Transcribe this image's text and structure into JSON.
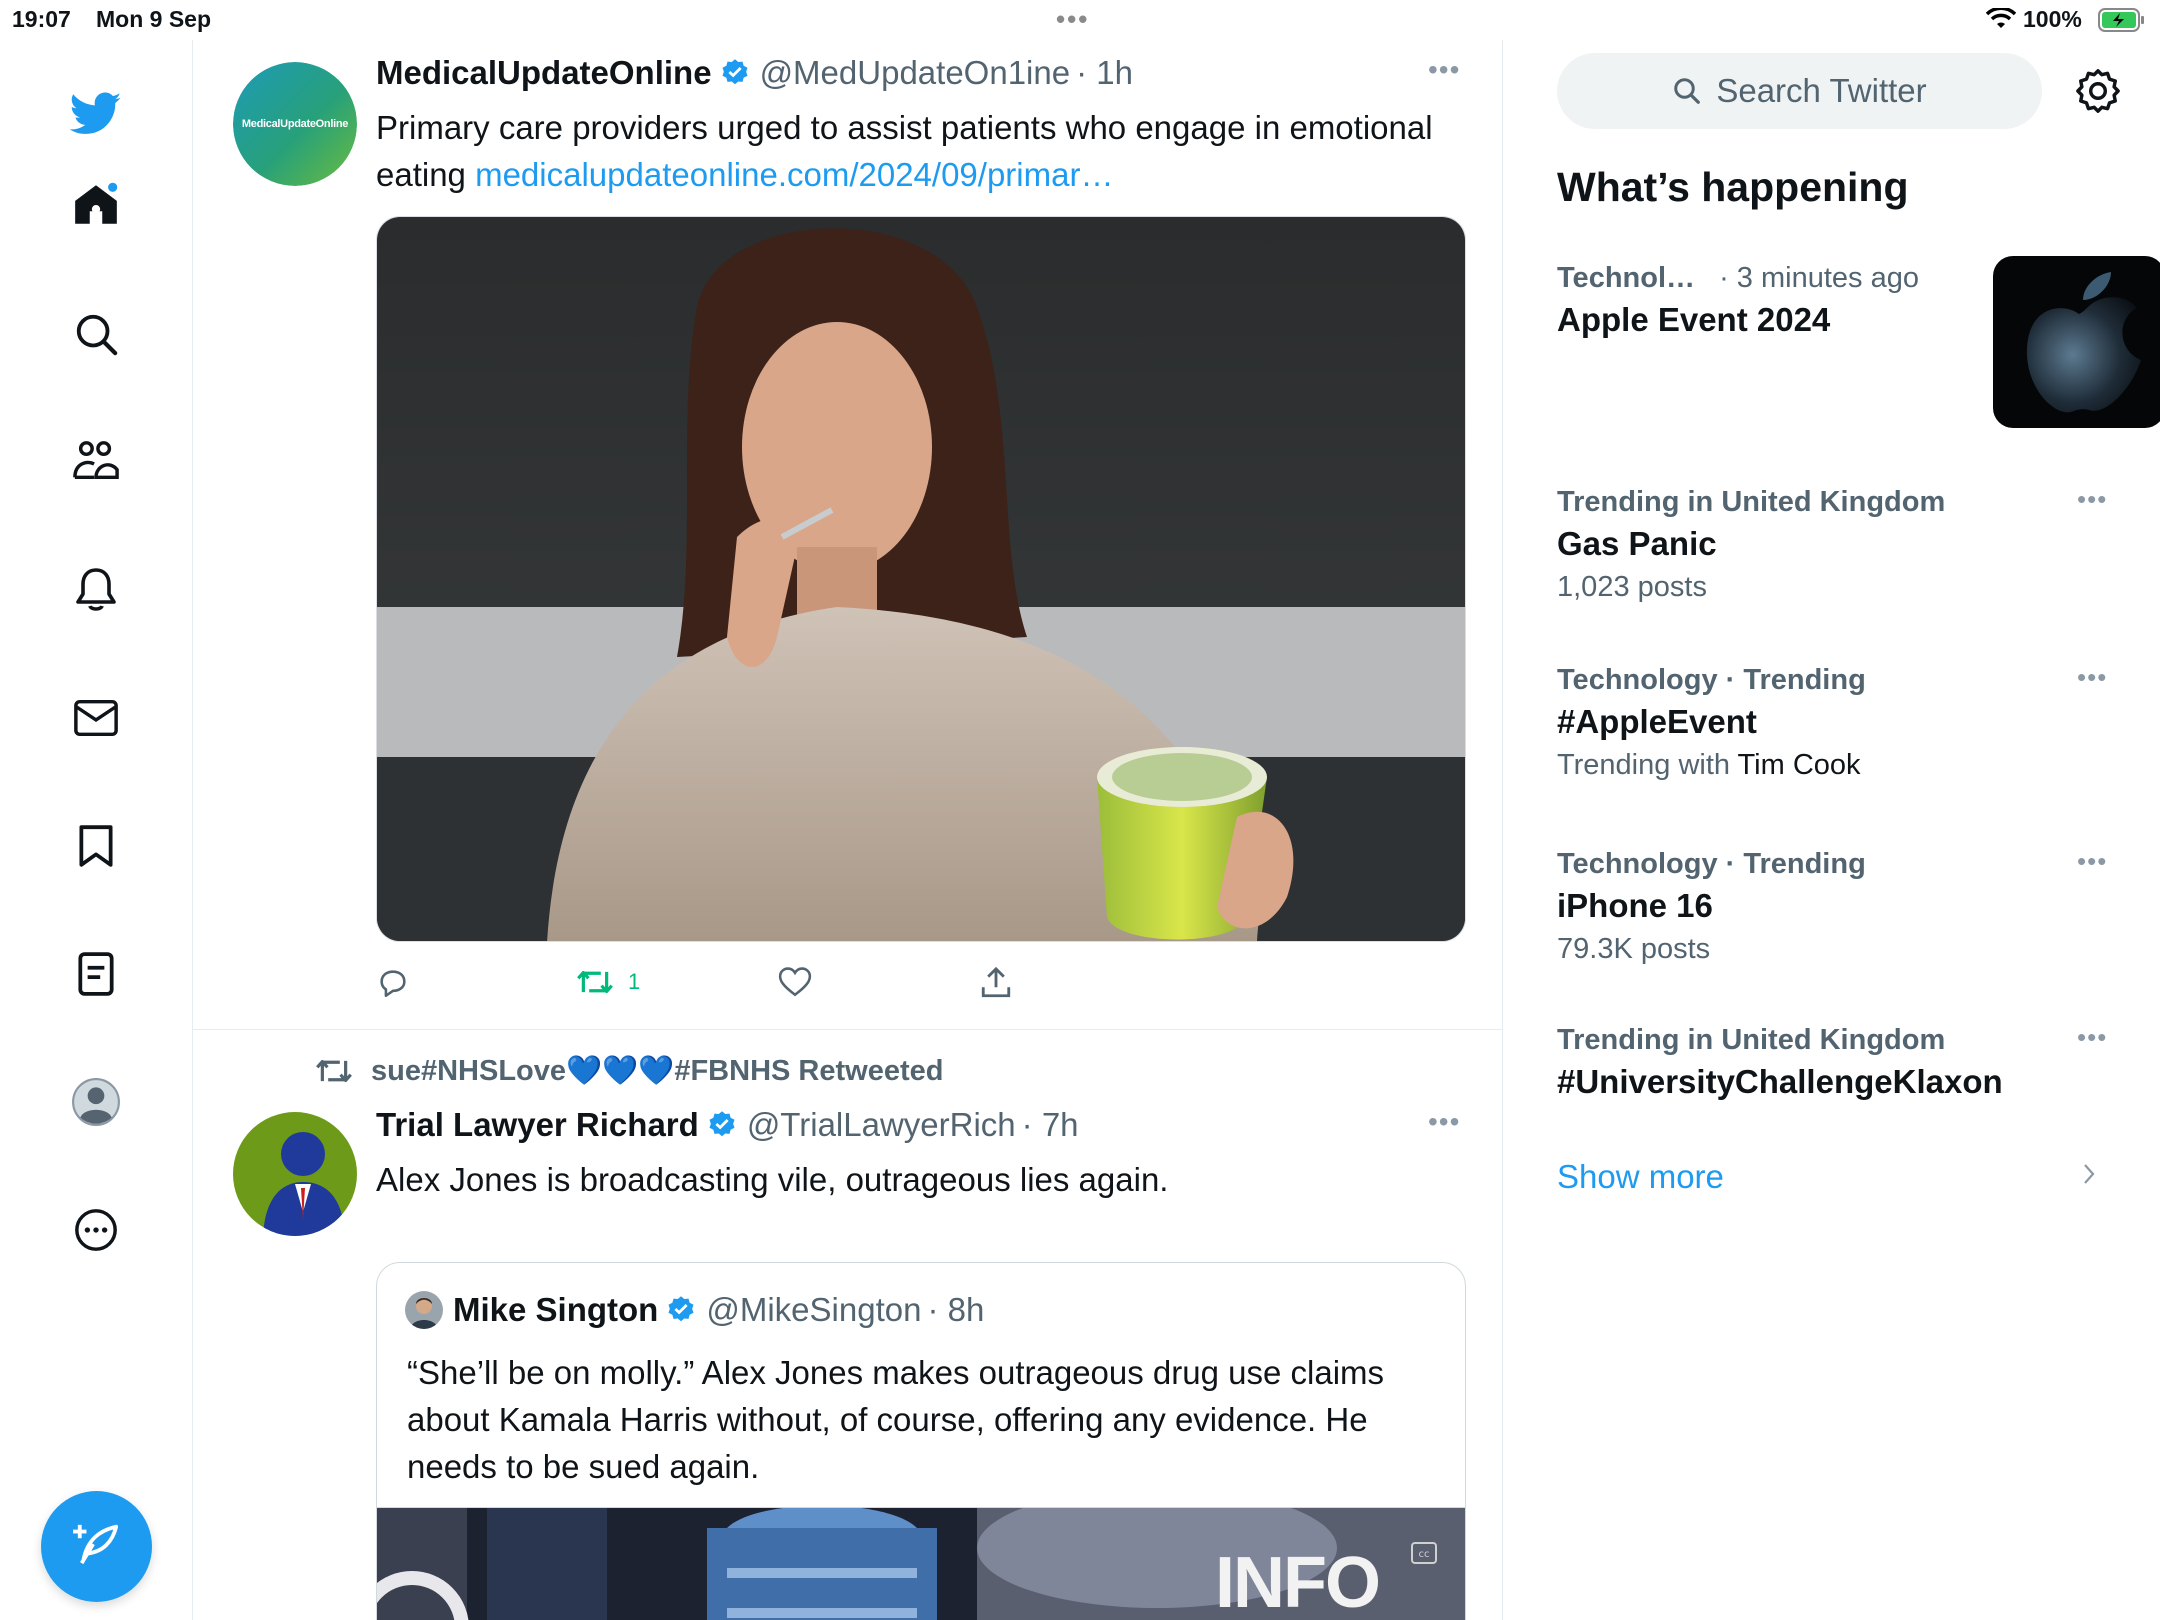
{
  "status_bar": {
    "time": "19:07",
    "date": "Mon 9 Sep",
    "battery": "100%"
  },
  "nav": {
    "items": [
      "home-icon",
      "search-icon",
      "communities-icon",
      "notifications-icon",
      "messages-icon",
      "bookmarks-icon",
      "lists-icon",
      "profile-icon",
      "more-icon"
    ],
    "compose_icon": "compose-tweet-icon"
  },
  "timeline": {
    "tweets": [
      {
        "avatar_text": "MedicalUpdateOnline",
        "name": "MedicalUpdateOnline",
        "handle": "@MedUpdateOn1ine",
        "time": "· 1h",
        "text": "Primary care providers urged to assist patients who engage in emotional eating ",
        "link": "medicalupdateonline.com/2024/09/primar…",
        "retweet_count": "1"
      },
      {
        "retweeted_by": "sue#NHSLove💙💙💙#FBNHS Retweeted",
        "name": "Trial Lawyer Richard",
        "handle": "@TrialLawyerRich",
        "time": "· 7h",
        "text": "Alex Jones is broadcasting vile, outrageous lies again.",
        "quote": {
          "name": "Mike Sington",
          "handle": "@MikeSington",
          "time": "· 8h",
          "text": "“She’ll be on molly.” Alex Jones makes outrageous drug use claims about Kamala Harris without, of course, offering any evidence. He needs to be sued again.",
          "media_text": "INFO WARS"
        }
      }
    ]
  },
  "sidebar": {
    "search_placeholder": "Search Twitter",
    "heading": "What’s happening",
    "trends": [
      {
        "category": "Technol…",
        "time": "· 3 minutes ago",
        "title": "Apple Event 2024"
      },
      {
        "category": "Trending in United Kingdom",
        "title": "Gas Panic",
        "sub": "1,023 posts"
      },
      {
        "category": "Technology · Trending",
        "title": "#AppleEvent",
        "sub_prefix": "Trending with ",
        "sub_name": "Tim Cook"
      },
      {
        "category": "Technology · Trending",
        "title": "iPhone 16",
        "sub": "79.3K posts"
      },
      {
        "category": "Trending in United Kingdom",
        "title": "#UniversityChallengeKlaxon"
      }
    ],
    "show_more": "Show more"
  },
  "colors": {
    "accent": "#1d9bf0",
    "retweet": "#00ba7c",
    "text_primary": "#0f1419",
    "text_secondary": "#536471"
  }
}
